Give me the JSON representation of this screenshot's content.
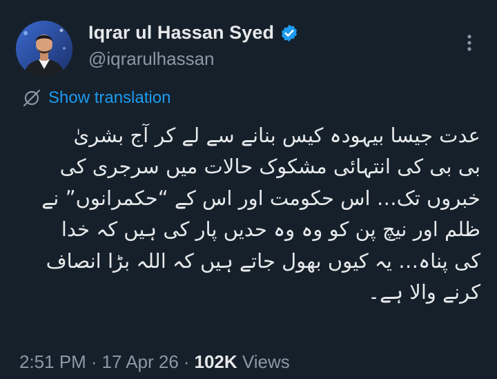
{
  "author": {
    "display_name": "Iqrar ul Hassan Syed",
    "handle": "@iqrarulhassan",
    "verified": true
  },
  "actions": {
    "more_icon": "more-vertical-icon"
  },
  "translation": {
    "label": "Show translation",
    "icon": "translate-globe-icon"
  },
  "tweet": {
    "lines": [
      "عدت جیسا بیہودہ کیس بنانے سے لے کر آج بشریٰ",
      "بی بی کی انتہائی مشکوک حالات میں سرجری کی",
      "خبروں تک… اس حکومت اور اس کے “حکمرانوں” نے",
      "ظلم اور نیچ پن کو وہ وہ حدیں پار کی ہیں کہ خدا",
      "کی پناہ… یہ کیوں بھول جاتے ہیں کہ اللہ بڑا انصاف",
      "کرنے والا ہے۔"
    ]
  },
  "meta": {
    "time": "2:51 PM",
    "separator1": "·",
    "date": "17 Apr 26",
    "separator2": "·",
    "views_count": "102K",
    "views_label": "Views"
  },
  "colors": {
    "background": "#15202b",
    "text": "#e7e9ea",
    "muted": "#8b98a5",
    "accent": "#1d9bf0"
  }
}
